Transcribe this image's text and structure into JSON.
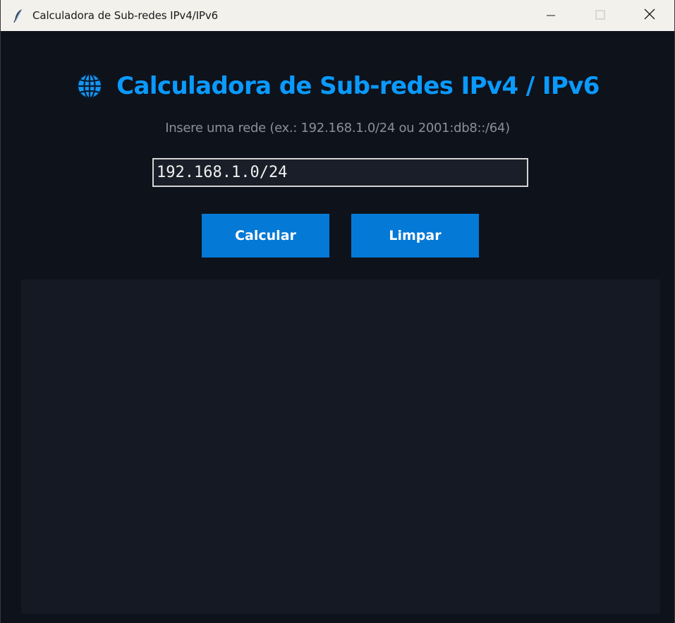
{
  "window": {
    "title": "Calculadora de Sub-redes IPv4/IPv6",
    "icon": "feather-icon",
    "controls": [
      "minimize-icon",
      "maximize-icon",
      "close-icon"
    ]
  },
  "header": {
    "icon": "globe-icon",
    "title": "Calculadora de Sub-redes IPv4 / IPv6",
    "subtitle": "Insere uma rede (ex.: 192.168.1.0/24 ou 2001:db8::/64)"
  },
  "input": {
    "value": "192.168.1.0/24",
    "placeholder": ""
  },
  "buttons": {
    "calculate_label": "Calcular",
    "clear_label": "Limpar"
  },
  "output": {
    "text": ""
  },
  "colors": {
    "accent": "#0a9aff",
    "button": "#0479d6",
    "background": "#0e121b",
    "output_bg": "#141923",
    "subtitle": "#8c8f96"
  }
}
